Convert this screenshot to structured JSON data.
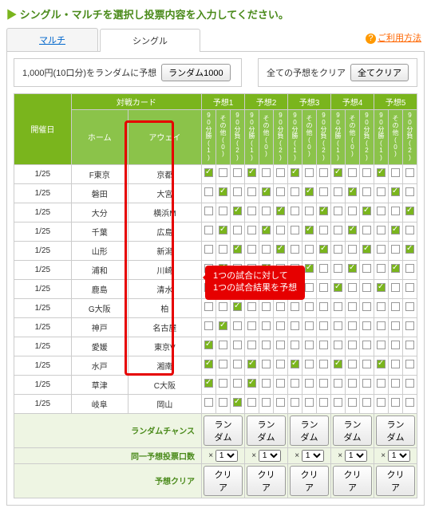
{
  "title": "シングル・マルチを選択し投票内容を入力してください。",
  "tabs": {
    "multi": "マルチ",
    "single": "シングル"
  },
  "help": "ご利用方法",
  "toolbar": {
    "random_label": "1,000円(10口分)をランダムに予想",
    "random_btn": "ランダム1000",
    "clear_label": "全ての予想をクリア",
    "clear_btn": "全てクリア"
  },
  "headers": {
    "date": "開催日",
    "card": "対戦カード",
    "home": "ホーム",
    "away": "アウェイ",
    "yoso": [
      "予想1",
      "予想2",
      "予想3",
      "予想4",
      "予想5"
    ],
    "sub": [
      "90分勝(1)",
      "その他(0)",
      "90分負(2)"
    ]
  },
  "rows": [
    {
      "date": "1/25",
      "home": "F東京",
      "away": "京都",
      "p": [
        [
          1,
          0,
          0
        ],
        [
          1,
          0,
          0
        ],
        [
          1,
          0,
          0
        ],
        [
          1,
          0,
          0
        ],
        [
          1,
          0,
          0
        ]
      ]
    },
    {
      "date": "1/25",
      "home": "磐田",
      "away": "大宮",
      "p": [
        [
          0,
          1,
          0
        ],
        [
          0,
          1,
          0
        ],
        [
          0,
          1,
          0
        ],
        [
          0,
          1,
          0
        ],
        [
          0,
          1,
          0
        ]
      ]
    },
    {
      "date": "1/25",
      "home": "大分",
      "away": "横浜M",
      "p": [
        [
          0,
          0,
          1
        ],
        [
          0,
          0,
          1
        ],
        [
          0,
          0,
          1
        ],
        [
          0,
          0,
          1
        ],
        [
          0,
          0,
          1
        ]
      ]
    },
    {
      "date": "1/25",
      "home": "千葉",
      "away": "広島",
      "p": [
        [
          0,
          1,
          0
        ],
        [
          0,
          1,
          0
        ],
        [
          0,
          1,
          0
        ],
        [
          0,
          1,
          0
        ],
        [
          0,
          1,
          0
        ]
      ]
    },
    {
      "date": "1/25",
      "home": "山形",
      "away": "新潟",
      "p": [
        [
          0,
          0,
          1
        ],
        [
          0,
          0,
          1
        ],
        [
          0,
          0,
          1
        ],
        [
          0,
          0,
          1
        ],
        [
          0,
          0,
          1
        ]
      ]
    },
    {
      "date": "1/25",
      "home": "浦和",
      "away": "川崎",
      "p": [
        [
          0,
          1,
          0
        ],
        [
          0,
          1,
          0
        ],
        [
          0,
          1,
          0
        ],
        [
          0,
          1,
          0
        ],
        [
          0,
          1,
          0
        ]
      ]
    },
    {
      "date": "1/25",
      "home": "鹿島",
      "away": "清水",
      "p": [
        [
          1,
          0,
          0
        ],
        [
          1,
          0,
          0
        ],
        [
          1,
          0,
          0
        ],
        [
          1,
          0,
          0
        ],
        [
          1,
          0,
          0
        ]
      ]
    },
    {
      "date": "1/25",
      "home": "G大阪",
      "away": "柏",
      "p": [
        [
          0,
          0,
          1
        ],
        [
          0,
          0,
          0
        ],
        [
          0,
          0,
          0
        ],
        [
          0,
          0,
          0
        ],
        [
          0,
          0,
          0
        ]
      ]
    },
    {
      "date": "1/25",
      "home": "神戸",
      "away": "名古屋",
      "p": [
        [
          0,
          1,
          0
        ],
        [
          0,
          0,
          0
        ],
        [
          0,
          0,
          0
        ],
        [
          0,
          0,
          0
        ],
        [
          0,
          0,
          0
        ]
      ]
    },
    {
      "date": "1/25",
      "home": "愛媛",
      "away": "東京V",
      "p": [
        [
          1,
          0,
          0
        ],
        [
          0,
          0,
          0
        ],
        [
          0,
          0,
          0
        ],
        [
          0,
          0,
          0
        ],
        [
          0,
          0,
          0
        ]
      ]
    },
    {
      "date": "1/25",
      "home": "水戸",
      "away": "湘南",
      "p": [
        [
          1,
          0,
          0
        ],
        [
          1,
          0,
          0
        ],
        [
          1,
          0,
          0
        ],
        [
          1,
          0,
          0
        ],
        [
          1,
          0,
          0
        ]
      ]
    },
    {
      "date": "1/25",
      "home": "草津",
      "away": "C大阪",
      "p": [
        [
          1,
          0,
          0
        ],
        [
          1,
          0,
          0
        ],
        [
          0,
          0,
          0
        ],
        [
          0,
          0,
          0
        ],
        [
          0,
          0,
          0
        ]
      ]
    },
    {
      "date": "1/25",
      "home": "岐阜",
      "away": "岡山",
      "p": [
        [
          0,
          0,
          1
        ],
        [
          0,
          0,
          0
        ],
        [
          0,
          0,
          0
        ],
        [
          0,
          0,
          0
        ],
        [
          0,
          0,
          0
        ]
      ]
    }
  ],
  "footer": {
    "random_chance": "ランダムチャンス",
    "random_btn": "ランダム",
    "multiplier": "同一予想投票口数",
    "mult_prefix": "×",
    "mult_val": "1",
    "clear": "予想クリア",
    "clear_btn": "クリア"
  },
  "callout": "1つの試合に対して\n1つの試合結果を予想"
}
